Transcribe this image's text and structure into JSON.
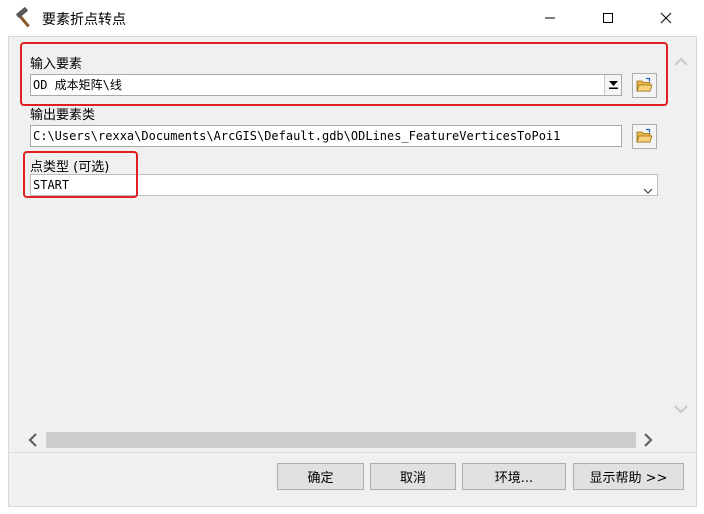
{
  "window": {
    "title": "要素折点转点",
    "title_icon": "hammer-icon",
    "minimize_glyph": "—",
    "maximize_glyph": "☐",
    "close_glyph": "✕"
  },
  "form": {
    "input_features": {
      "label": "输入要素",
      "value": "OD 成本矩阵\\线",
      "control": "dropdown-combo"
    },
    "output_feature_class": {
      "label": "输出要素类",
      "value": "C:\\Users\\rexxa\\Documents\\ArcGIS\\Default.gdb\\ODLines_FeatureVerticesToPoi1"
    },
    "point_type": {
      "label": "点类型 (可选)",
      "value": "START",
      "control": "select"
    }
  },
  "buttons": {
    "ok": "确定",
    "cancel": "取消",
    "environments": "环境...",
    "show_help": "显示帮助 >>"
  },
  "highlight_color": "#e02020",
  "icons": {
    "browse": "folder-open-icon",
    "scroll_up": "chevron-up-icon",
    "scroll_down": "chevron-down-icon",
    "scroll_left": "chevron-left-icon",
    "scroll_right": "chevron-right-icon"
  }
}
